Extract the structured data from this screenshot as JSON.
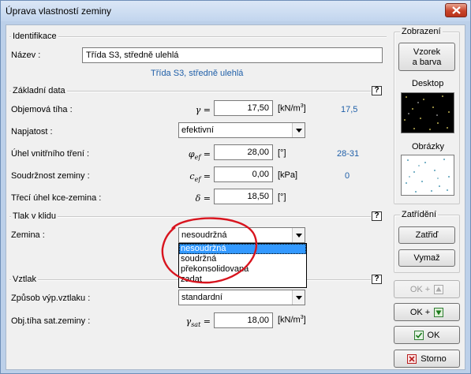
{
  "window": {
    "title": "Úprava vlastností zeminy"
  },
  "identifikace": {
    "title": "Identifikace",
    "name_label": "Název :",
    "name_value": "Třída S3, středně ulehlá",
    "suggestion": "Třída S3, středně ulehlá"
  },
  "zakladni": {
    "title": "Základní data",
    "unit_weight": {
      "label": "Objemová tíha :",
      "symbol": "γ",
      "eq": "=",
      "value": "17,50",
      "unit_pre": "[kN/m",
      "unit_sup": "3",
      "unit_post": "]",
      "ref": "17,5"
    },
    "napjatost": {
      "label": "Napjatost :",
      "value": "efektivní"
    },
    "friction": {
      "label": "Úhel vnitřního tření :",
      "symbol": "φ",
      "sub": "ef",
      "eq": "=",
      "value": "28,00",
      "unit": "[°]",
      "ref": "28-31"
    },
    "cohesion": {
      "label": "Soudržnost zeminy :",
      "symbol": "c",
      "sub": "ef",
      "eq": "=",
      "value": "0,00",
      "unit": "[kPa]",
      "ref": "0"
    },
    "delta": {
      "label": "Třecí úhel kce-zemina :",
      "symbol": "δ",
      "eq": "=",
      "value": "18,50",
      "unit": "[°]"
    }
  },
  "tlak": {
    "title": "Tlak v klidu",
    "zemina_label": "Zemina :",
    "zemina_value": "nesoudržná",
    "options": [
      "nesoudržná",
      "soudržná",
      "překonsolidovaná",
      "zadat"
    ],
    "selected_index": 0
  },
  "vztlak": {
    "title": "Vztlak",
    "method_label": "Způsob výp.vztlaku :",
    "method_value": "standardní",
    "sat": {
      "label": "Obj.tíha sat.zeminy :",
      "symbol": "γ",
      "sub": "sat",
      "eq": "=",
      "value": "18,00",
      "unit_pre": "[kN/m",
      "unit_sup": "3",
      "unit_post": "]"
    }
  },
  "zobrazeni": {
    "title": "Zobrazení",
    "sample_btn_line1": "Vzorek",
    "sample_btn_line2": "a barva",
    "desktop_label": "Desktop",
    "images_label": "Obrázky"
  },
  "zatrideni": {
    "title": "Zatřídění",
    "classify_btn": "Zatřiď",
    "clear_btn": "Vymaž"
  },
  "buttons": {
    "ok_up": "OK +",
    "ok_down": "OK +",
    "ok": "OK",
    "cancel": "Storno"
  },
  "help_glyph": "?",
  "colors": {
    "accent_blue": "#1f5fa8",
    "selection": "#3399ff",
    "annotation_red": "#d8141e"
  }
}
